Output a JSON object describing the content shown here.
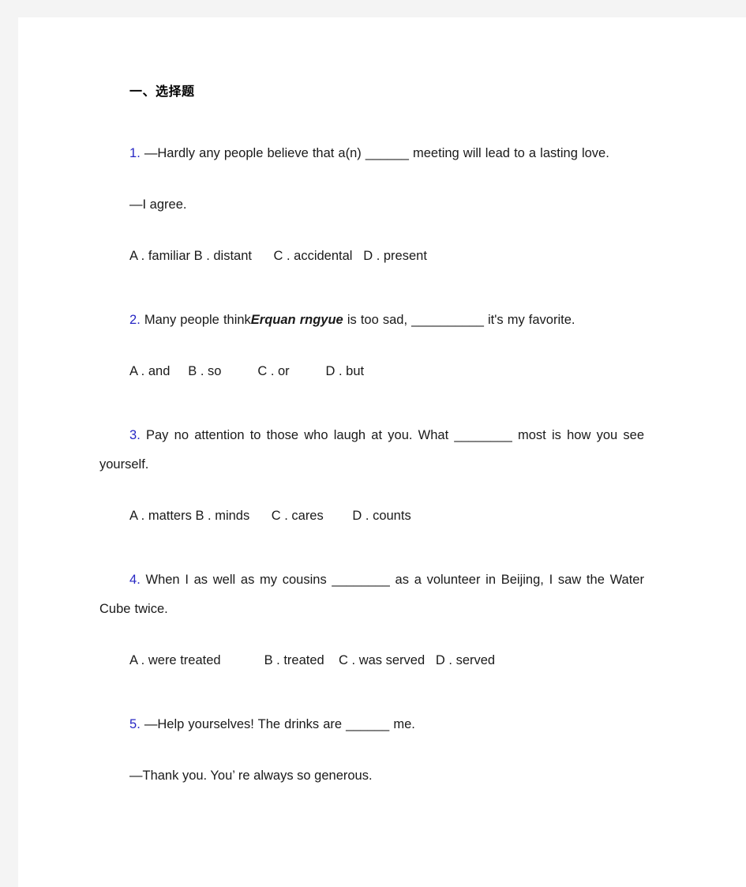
{
  "document": {
    "section_heading": "一、选择题",
    "questions": [
      {
        "number": "1",
        "number_sep": ".",
        "stem_lines": [
          "—Hardly any people believe that a(n) ______ meeting will lead to a lasting love."
        ],
        "dialog_reply": "—I agree.",
        "options_text": "A . familiar B . distant      C . accidental   D . present",
        "options": [
          {
            "letter": "A",
            "label": "familiar"
          },
          {
            "letter": "B",
            "label": "distant"
          },
          {
            "letter": "C",
            "label": "accidental"
          },
          {
            "letter": "D",
            "label": "present"
          }
        ]
      },
      {
        "number": "2",
        "number_sep": ".",
        "stem_prefix": "Many people think",
        "stem_italic": "Erquan rngyue",
        "stem_suffix": " is too sad,  __________ it's my favorite.",
        "options_text": "A . and     B . so          C . or          D . but",
        "options": [
          {
            "letter": "A",
            "label": "and"
          },
          {
            "letter": "B",
            "label": "so"
          },
          {
            "letter": "C",
            "label": "or"
          },
          {
            "letter": "D",
            "label": "but"
          }
        ]
      },
      {
        "number": "3",
        "number_sep": ".",
        "stem_lines": [
          "Pay no attention to those who laugh at you. What ________ most is how you see yourself."
        ],
        "options_text": "A . matters B . minds      C . cares        D . counts",
        "options": [
          {
            "letter": "A",
            "label": "matters"
          },
          {
            "letter": "B",
            "label": "minds"
          },
          {
            "letter": "C",
            "label": "cares"
          },
          {
            "letter": "D",
            "label": "counts"
          }
        ]
      },
      {
        "number": "4",
        "number_sep": ".",
        "stem_lines": [
          "When I as well as my cousins ________ as a volunteer in Beijing,  I saw the Water Cube twice."
        ],
        "options_text": "A . were treated            B . treated    C . was served   D . served",
        "options": [
          {
            "letter": "A",
            "label": "were treated"
          },
          {
            "letter": "B",
            "label": "treated"
          },
          {
            "letter": "C",
            "label": "was served"
          },
          {
            "letter": "D",
            "label": "served"
          }
        ]
      },
      {
        "number": "5",
        "number_sep": ".",
        "stem_lines": [
          "—Help yourselves! The drinks are ______ me."
        ],
        "dialog_reply": "—Thank you. You’ re always so generous."
      }
    ]
  },
  "colors": {
    "page_background": "#f4f4f4",
    "sheet_background": "#ffffff",
    "text": "#1a1a1a",
    "question_number": "#2727c4"
  }
}
